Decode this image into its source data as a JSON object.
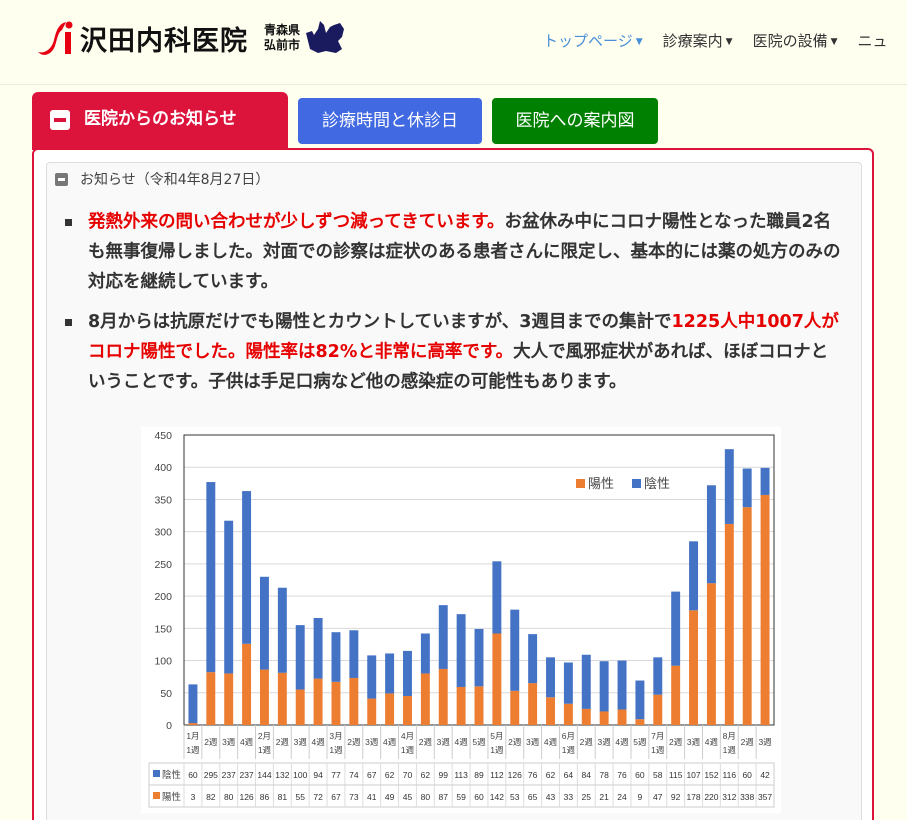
{
  "header": {
    "logo_name": "沢田内科医院",
    "place_line1": "青森県",
    "place_line2": "弘前市",
    "nav": [
      {
        "label": "トップページ",
        "active": true
      },
      {
        "label": "診療案内",
        "active": false
      },
      {
        "label": "医院の設備",
        "active": false
      },
      {
        "label": "ニュ",
        "active": false
      }
    ]
  },
  "tabs": {
    "news": "医院からのお知らせ",
    "hours": "診療時間と休診日",
    "map": "医院への案内図"
  },
  "notice": {
    "heading": "お知らせ（令和4年8月27日）",
    "p1_red": "発熱外来の問い合わせが少しずつ減ってきています。",
    "p1_rest": "お盆休み中にコロナ陽性となった職員2名も無事復帰しました。対面での診察は症状のある患者さんに限定し、基本的には薬の処方のみの対応を継続しています。",
    "p2_a": "8月からは抗原だけでも陽性とカウントしていますが、3週目までの集計で",
    "p2_red": "1225人中1007人がコロナ陽性でした。陽性率は82%と非常に高率です。",
    "p2_b": "大人で風邪症状があれば、ほぼコロナということです。子供は手足口病など他の感染症の可能性もあります。"
  },
  "chart_data": {
    "type": "bar",
    "stacked": true,
    "ylim": [
      0,
      450
    ],
    "yticks": [
      0,
      50,
      100,
      150,
      200,
      250,
      300,
      350,
      400,
      450
    ],
    "grid": true,
    "legend_position": "top-right",
    "categories": [
      "1月 1週",
      "2週",
      "3週",
      "4週",
      "2月 1週",
      "2週",
      "3週",
      "4週",
      "3月 1週",
      "2週",
      "3週",
      "4週",
      "4月 1週",
      "2週",
      "3週",
      "4週",
      "5週",
      "5月 1週",
      "2週",
      "3週",
      "4週",
      "6月 1週",
      "2週",
      "3週",
      "4週",
      "5週",
      "7月 1週",
      "2週",
      "3週",
      "4週",
      "8月 1週",
      "2週",
      "3週"
    ],
    "series": [
      {
        "name": "陽性",
        "color": "#ed7d31",
        "values": [
          3,
          82,
          80,
          126,
          86,
          81,
          55,
          72,
          67,
          73,
          41,
          49,
          45,
          80,
          87,
          59,
          60,
          142,
          53,
          65,
          43,
          33,
          25,
          21,
          24,
          9,
          47,
          92,
          178,
          220,
          312,
          338,
          357
        ]
      },
      {
        "name": "陰性",
        "color": "#4472c4",
        "values": [
          60,
          295,
          237,
          237,
          144,
          132,
          100,
          94,
          77,
          74,
          67,
          62,
          70,
          62,
          99,
          113,
          89,
          112,
          126,
          76,
          62,
          64,
          84,
          78,
          76,
          60,
          58,
          115,
          107,
          152,
          116,
          60,
          42
        ]
      }
    ]
  }
}
